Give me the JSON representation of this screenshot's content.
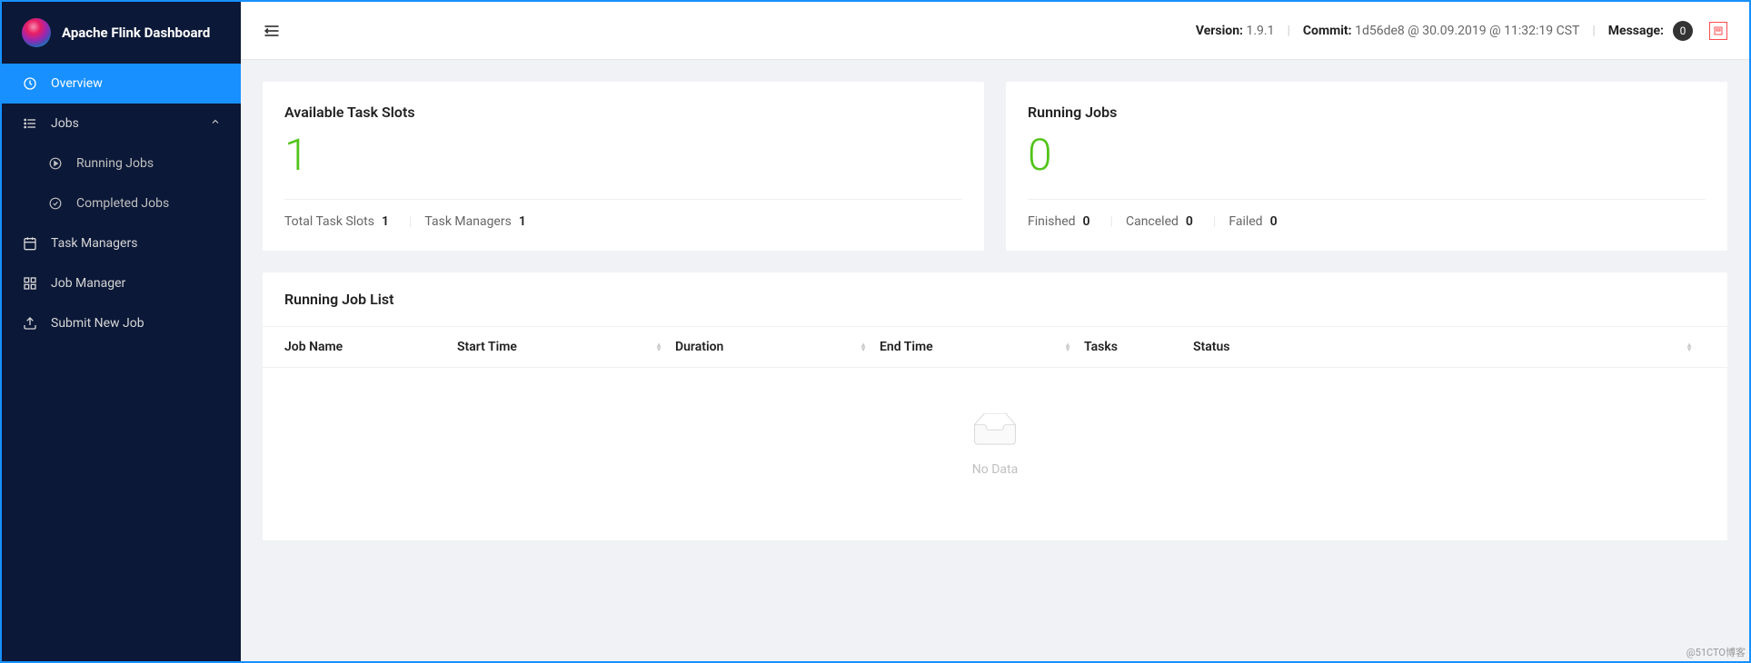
{
  "app_title": "Apache Flink Dashboard",
  "sidebar": {
    "items": [
      {
        "label": "Overview",
        "icon": "dashboard"
      },
      {
        "label": "Jobs",
        "icon": "list",
        "expanded": true
      },
      {
        "label": "Task Managers",
        "icon": "schedule"
      },
      {
        "label": "Job Manager",
        "icon": "build"
      },
      {
        "label": "Submit New Job",
        "icon": "upload"
      }
    ],
    "jobs_sub": [
      {
        "label": "Running Jobs",
        "icon": "play"
      },
      {
        "label": "Completed Jobs",
        "icon": "check"
      }
    ]
  },
  "topbar": {
    "version_label": "Version:",
    "version_value": "1.9.1",
    "commit_label": "Commit:",
    "commit_value": "1d56de8 @ 30.09.2019 @ 11:32:19 CST",
    "message_label": "Message:",
    "message_count": "0"
  },
  "cards": {
    "slots": {
      "title": "Available Task Slots",
      "value": "1",
      "total_label": "Total Task Slots",
      "total_value": "1",
      "tm_label": "Task Managers",
      "tm_value": "1"
    },
    "jobs": {
      "title": "Running Jobs",
      "value": "0",
      "finished_label": "Finished",
      "finished_value": "0",
      "canceled_label": "Canceled",
      "canceled_value": "0",
      "failed_label": "Failed",
      "failed_value": "0"
    }
  },
  "table": {
    "title": "Running Job List",
    "columns": {
      "name": "Job Name",
      "start": "Start Time",
      "duration": "Duration",
      "end": "End Time",
      "tasks": "Tasks",
      "status": "Status"
    },
    "empty_text": "No Data"
  },
  "watermark": "@51CTO博客"
}
